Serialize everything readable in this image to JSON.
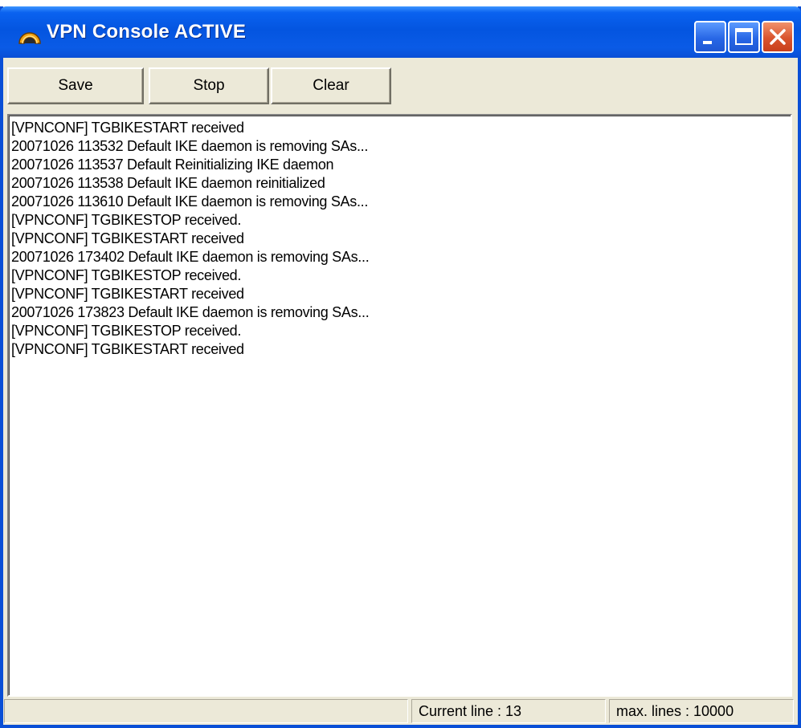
{
  "window": {
    "title": "VPN Console ACTIVE",
    "icon": "vpn-arch-icon",
    "controls": {
      "minimize": "minimize-icon",
      "maximize": "maximize-icon",
      "close": "close-icon"
    }
  },
  "toolbar": {
    "save_label": "Save",
    "stop_label": "Stop",
    "clear_label": "Clear"
  },
  "console": {
    "lines": [
      "[VPNCONF] TGBIKESTART received",
      "20071026 113532 Default IKE daemon is removing SAs...",
      "20071026 113537 Default Reinitializing IKE daemon",
      "20071026 113538 Default IKE daemon reinitialized",
      "20071026 113610 Default IKE daemon is removing SAs...",
      "[VPNCONF] TGBIKESTOP received.",
      "[VPNCONF] TGBIKESTART received",
      "20071026 173402 Default IKE daemon is removing SAs...",
      "[VPNCONF] TGBIKESTOP received.",
      "[VPNCONF] TGBIKESTART received",
      "20071026 173823 Default IKE daemon is removing SAs...",
      "[VPNCONF] TGBIKESTOP received.",
      "[VPNCONF] TGBIKESTART received"
    ]
  },
  "statusbar": {
    "current_line": "Current line : 13",
    "max_lines": "max. lines : 10000"
  },
  "colors": {
    "titlebar": "#0455e0",
    "close_button": "#d9542e",
    "window_face": "#ece9d8"
  }
}
